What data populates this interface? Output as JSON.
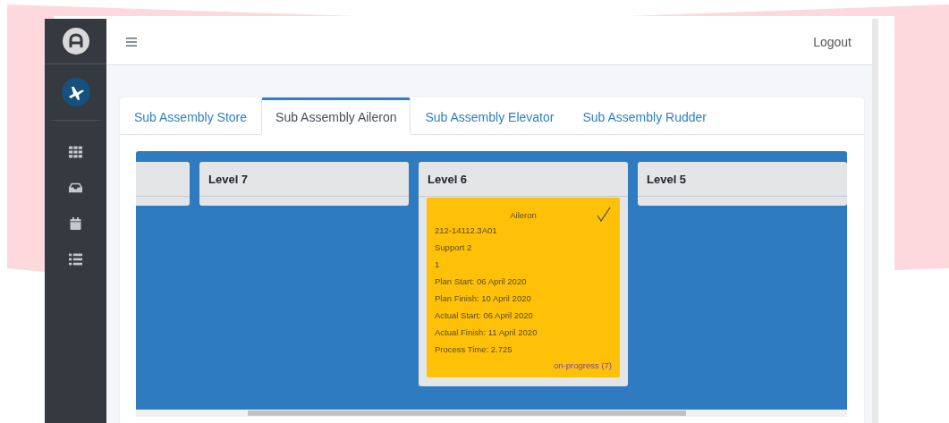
{
  "topbar": {
    "logout": "Logout"
  },
  "tabs": [
    {
      "label": "Sub Assembly Store",
      "selected": false
    },
    {
      "label": "Sub Assembly Aileron",
      "selected": true
    },
    {
      "label": "Sub Assembly Elevator",
      "selected": false
    },
    {
      "label": "Sub Assembly Rudder",
      "selected": false
    }
  ],
  "columns": [
    {
      "kind": "cut_off"
    },
    {
      "kind": "full",
      "title": "Level 7"
    },
    {
      "kind": "full",
      "title": "Level 6",
      "cards": [
        {
          "title": "Aileron",
          "checked": true,
          "lines": [
            "212-14112.3A01",
            "Support 2",
            "1",
            "Plan Start: 06 April 2020",
            "Plan Finish: 10 April 2020",
            "Actual Start: 06 April 2020",
            "Actual Finish: 11 April 2020",
            "Process Time: 2.725"
          ],
          "status": "on-progress (7)"
        }
      ]
    },
    {
      "kind": "full",
      "title": "Level 5"
    }
  ]
}
